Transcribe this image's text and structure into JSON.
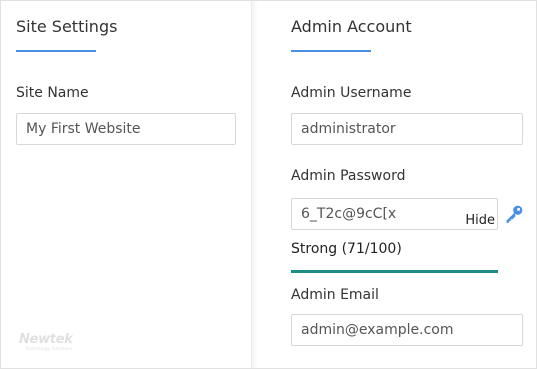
{
  "site_settings": {
    "title": "Site Settings",
    "site_name": {
      "label": "Site Name",
      "value": "My First Website"
    }
  },
  "admin_account": {
    "title": "Admin Account",
    "username": {
      "label": "Admin Username",
      "value": "administrator"
    },
    "password": {
      "label": "Admin Password",
      "value": "6_T2c@9cC[x",
      "toggle_label": "Hide",
      "generate_icon": "key-icon",
      "strength_text": "Strong (71/100)",
      "strength_score": 71
    },
    "email": {
      "label": "Admin Email",
      "value": "admin@example.com"
    }
  },
  "branding": {
    "logo_text": "Newtek",
    "logo_tagline": "Technology Solutions"
  },
  "colors": {
    "accent_underline": "#4a90e2",
    "strength_bar": "#1f8c85",
    "key_icon": "#4a90e2"
  }
}
